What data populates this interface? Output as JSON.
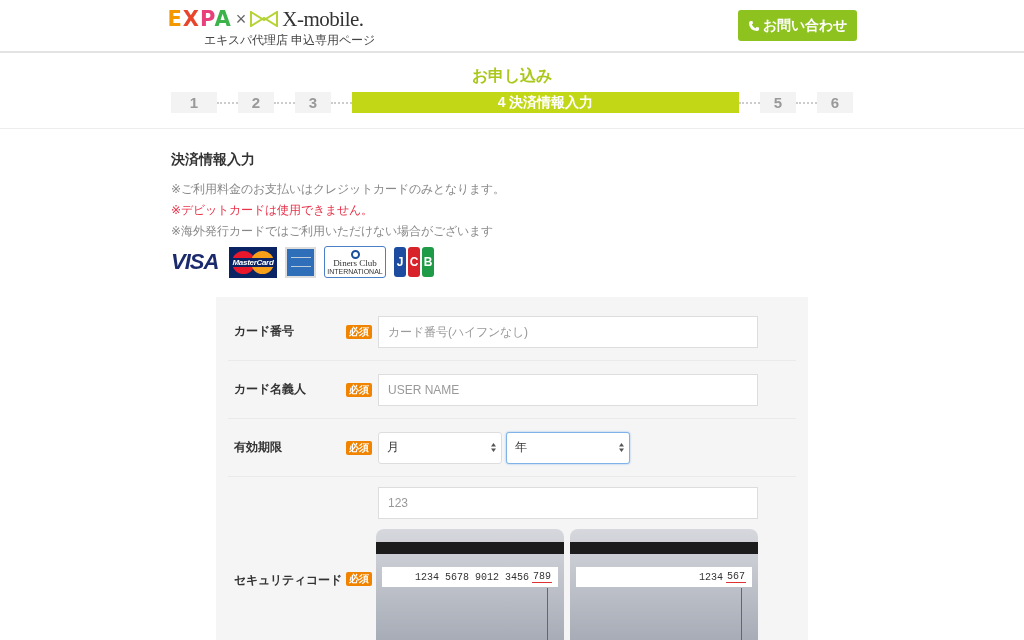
{
  "header": {
    "logo_letters": [
      {
        "text": "E",
        "color": "#f39800"
      },
      {
        "text": "X",
        "color": "#e8452c"
      },
      {
        "text": "P",
        "color": "#e8407a"
      },
      {
        "text": "A",
        "color": "#3bb34a"
      }
    ],
    "logo_cross": "×",
    "partner_name": "X-mobile.",
    "subtitle": "エキスパ代理店 申込専用ページ",
    "contact_button": "お問い合わせ"
  },
  "steps_title": "お申し込み",
  "steps": [
    {
      "label": "1",
      "selected": false
    },
    {
      "label": "2",
      "selected": false
    },
    {
      "label": "3",
      "selected": false
    },
    {
      "label": "4 決済情報入力",
      "selected": true
    },
    {
      "label": "5",
      "selected": false
    },
    {
      "label": "6",
      "selected": false
    }
  ],
  "section_title": "決済情報入力",
  "notes": [
    {
      "text": "※ご利用料金のお支払いはクレジットカードのみとなります。",
      "kind": "normal"
    },
    {
      "text": "※デビットカードは使用できません。",
      "kind": "warning"
    },
    {
      "text": "※海外発行カードではご利用いただけない場合がございます",
      "kind": "normal"
    }
  ],
  "card_brands": [
    {
      "kind": "visa",
      "text": "VISA"
    },
    {
      "kind": "mastercard",
      "text": "MasterCard"
    },
    {
      "kind": "amex"
    },
    {
      "kind": "diners",
      "text": "Diners Club",
      "subtext": "INTERNATIONAL"
    },
    {
      "kind": "jcb",
      "letters": [
        "J",
        "C",
        "B"
      ]
    }
  ],
  "form_rows": [
    {
      "kind": "text",
      "label": "カード番号",
      "badge": "必須",
      "placeholder": "カード番号(ハイフンなし)"
    },
    {
      "kind": "text",
      "label": "カード名義人",
      "badge": "必須",
      "placeholder": "USER NAME"
    },
    {
      "kind": "select",
      "label": "有効期限",
      "badge": "必須",
      "selects": [
        {
          "value": "月",
          "focused": false
        },
        {
          "value": "年",
          "focused": true
        }
      ]
    },
    {
      "kind": "security",
      "label": "セキュリティコード",
      "badge": "必須",
      "placeholder": "123",
      "cards": [
        {
          "numbers": "1234 5678 9012 3456",
          "code": "789"
        },
        {
          "numbers": "1234",
          "code": "567"
        }
      ]
    }
  ]
}
